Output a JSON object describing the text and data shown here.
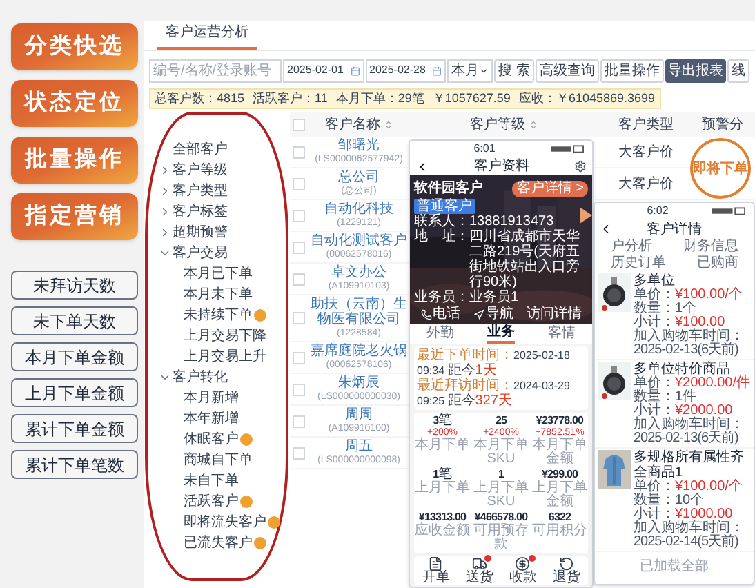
{
  "feature_tags": [
    "分类快选",
    "状态定位",
    "批量操作",
    "指定营销"
  ],
  "metric_tags": [
    "未拜访天数",
    "未下单天数",
    "本月下单金额",
    "上月下单金额",
    "累计下单金额",
    "累计下单笔数"
  ],
  "panel": {
    "tab": "客户运营分析",
    "search": {
      "placeholder": "编号/名称/登录账号"
    },
    "date_from": "2025-02-01",
    "date_to": "2025-02-28",
    "period": "本月",
    "buttons": [
      {
        "label": "搜 索",
        "kind": "plain"
      },
      {
        "label": "高级查询",
        "kind": "plain"
      },
      {
        "label": "批量操作",
        "kind": "plain"
      },
      {
        "label": "导出报表",
        "kind": "primary"
      },
      {
        "label": "线",
        "kind": "plain"
      }
    ],
    "summary": [
      "总客户数：4815",
      "活跃客户：11",
      "本月下单：29笔",
      "￥1057627.59",
      "应收：￥61045869.3699"
    ],
    "tree": [
      {
        "label": "全部客户",
        "hint": false
      },
      {
        "label": "客户等级",
        "expanded": false,
        "hint": false
      },
      {
        "label": "客户类型",
        "expanded": false,
        "hint": false
      },
      {
        "label": "客户标签",
        "expanded": false,
        "hint": false
      },
      {
        "label": "超期预警",
        "expanded": false,
        "hint": false
      },
      {
        "label": "客户交易",
        "expanded": true,
        "hint": false,
        "children": [
          {
            "label": "本月已下单",
            "hint": false
          },
          {
            "label": "本月未下单",
            "hint": false
          },
          {
            "label": "未持续下单",
            "hint": true
          },
          {
            "label": "上月交易下降",
            "hint": false
          },
          {
            "label": "上月交易上升",
            "hint": false
          }
        ]
      },
      {
        "label": "客户转化",
        "expanded": true,
        "hint": false,
        "children": [
          {
            "label": "本月新增",
            "hint": false
          },
          {
            "label": "本年新增",
            "hint": false
          },
          {
            "label": "休眠客户",
            "hint": true
          },
          {
            "label": "商城自下单",
            "hint": false
          },
          {
            "label": "未自下单",
            "hint": false
          },
          {
            "label": "活跃客户",
            "hint": true
          },
          {
            "label": "即将流失客户",
            "hint": true
          },
          {
            "label": "已流失客户",
            "hint": true
          }
        ]
      }
    ],
    "table": {
      "all_checked": false,
      "columns": [
        "客户名称",
        "客户等级",
        "客户类型",
        "预警分"
      ],
      "rows": [
        {
          "name": "邹曙光",
          "code": "(LS0000062577942)",
          "type": "大客户价",
          "checked": false
        },
        {
          "name": "总公司",
          "code": "(总公司)",
          "type": "大客户价",
          "checked": false
        },
        {
          "name": "自动化科技",
          "code": "(1229121)",
          "checked": false
        },
        {
          "name": "自动化测试客户",
          "code": "(00062578016)",
          "checked": false
        },
        {
          "name": "卓文办公",
          "code": "(A109910103)",
          "checked": false
        },
        {
          "name": "助扶（云南）生物医有限公司",
          "code": "(1228584)",
          "checked": false
        },
        {
          "name": "嘉席庭院老火锅",
          "code": "(00062578106)",
          "checked": false
        },
        {
          "name": "朱炳辰",
          "code": "(LS000000000030)",
          "checked": false
        },
        {
          "name": "周周",
          "code": "(A109910100)",
          "checked": false
        },
        {
          "name": "周五",
          "code": "(LS000000000098)",
          "checked": false
        }
      ]
    }
  },
  "phone1": {
    "time": "6:01",
    "title": "客户资料",
    "customer": {
      "name": "软件园客户",
      "detail_button": "客户详情 >",
      "tag": "普通客户",
      "fields": [
        {
          "label": "联系人：",
          "value": "13881913473"
        },
        {
          "label": "地　址：",
          "value": "四川省成都市天华二路219号(天府五街地铁站出入口旁行90米)"
        },
        {
          "label": "业务员：",
          "value": "业务员1"
        }
      ]
    },
    "actions": [
      {
        "label": "电话",
        "kind": "phone"
      },
      {
        "label": "导航",
        "kind": "navigate"
      },
      {
        "label": "访问详情",
        "kind": "plain"
      }
    ],
    "tabs": [
      {
        "label": "外勤",
        "selected": false
      },
      {
        "label": "业务",
        "selected": true
      },
      {
        "label": "客情",
        "selected": false
      }
    ],
    "recent": [
      {
        "label": "最近下单时间：",
        "value": "2025-02-18 09:34",
        "ago": "距今",
        "days": "1天"
      },
      {
        "label": "最近拜访时间：",
        "value": "2024-03-29 09:25",
        "ago": "距今",
        "days": "327天"
      }
    ],
    "stats": [
      {
        "value": "3",
        "unit": "笔",
        "change": "+200%",
        "label": "本月下单"
      },
      {
        "value": "25",
        "change": "+2400%",
        "label": "本月下单SKU"
      },
      {
        "value": "¥23778.00",
        "change": "+7852.51%",
        "label": "本月下单金额"
      },
      {
        "value": "1",
        "unit": "笔",
        "label": "上月下单"
      },
      {
        "value": "1",
        "label": "上月下单SKU"
      },
      {
        "value": "¥299.00",
        "label": "上月下单金额"
      },
      {
        "value": "¥13313.00",
        "label": "应收金额"
      },
      {
        "value": "¥466578.00",
        "label": "可用预存款"
      },
      {
        "value": "6322",
        "label": "可用积分"
      }
    ],
    "nav": [
      {
        "label": "开单",
        "kind": "order",
        "badge": false
      },
      {
        "label": "送货",
        "kind": "delivery",
        "badge": true
      },
      {
        "label": "收款",
        "kind": "payment",
        "badge": true
      },
      {
        "label": "退货",
        "kind": "return",
        "badge": false
      }
    ]
  },
  "phone2": {
    "time": "6:02",
    "title": "客户详情",
    "tabs": [
      "户分析",
      "财务信息",
      "历史订单",
      "已购商"
    ],
    "callout": "即将下单",
    "items": [
      {
        "kind": "watch",
        "name": "多单位",
        "price_label": "单价：",
        "price": "¥100.00/个",
        "qty_label": "数量：",
        "qty": "1个",
        "subtotal_label": "小计：",
        "subtotal": "¥100.00",
        "added_label": "加入购物车时间：",
        "added": "2025-02-13(6天前)"
      },
      {
        "kind": "watch",
        "name": "多单位特价商品",
        "price_label": "单价：",
        "price": "¥2000.00/件",
        "qty_label": "数量：",
        "qty": "1件",
        "subtotal_label": "小计：",
        "subtotal": "¥2000.00",
        "added_label": "加入购物车时间：",
        "added": "2025-02-13(6天前)"
      },
      {
        "kind": "shirt",
        "name": "多规格所有属性齐全商品1",
        "price_label": "单价：",
        "price": "¥100.00/个",
        "qty_label": "数量：",
        "qty": "10个",
        "subtotal_label": "小计：",
        "subtotal": "¥1000.00",
        "added_label": "加入购物车时间：",
        "added": "2025-02-14(5天前)"
      }
    ],
    "footer": "已加载全部"
  }
}
